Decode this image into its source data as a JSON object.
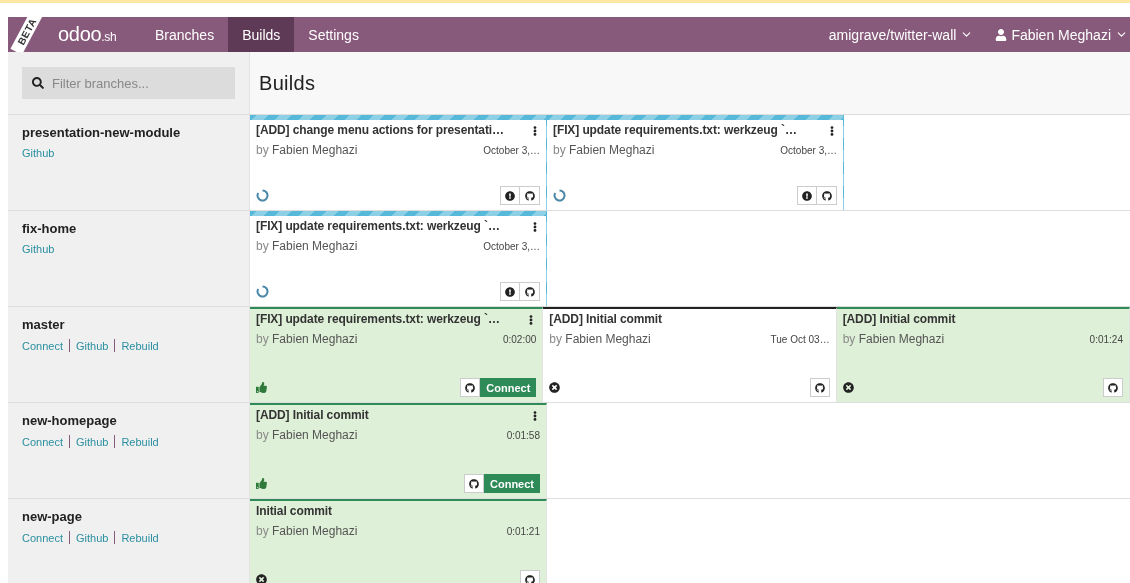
{
  "nav": {
    "beta": "BETA",
    "logo": "odoo",
    "logo_suffix": ".sh",
    "tabs": [
      {
        "label": "Branches",
        "selected": false
      },
      {
        "label": "Builds",
        "selected": true
      },
      {
        "label": "Settings",
        "selected": false
      }
    ],
    "repo": "amigrave/twitter-wall",
    "user": "Fabien Meghazi"
  },
  "search": {
    "placeholder": "Filter branches..."
  },
  "title": "Builds",
  "branches": [
    {
      "name": "presentation-new-module",
      "links": [
        "Github"
      ],
      "builds": [
        {
          "kind": "running",
          "icon": {
            "kind": "pending"
          },
          "menu": true,
          "title": "[ADD] change menu actions for presentati…",
          "by": "by",
          "author": "Fabien Meghazi",
          "time": "October 3,…",
          "actions": [
            {
              "kind": "alert"
            },
            {
              "kind": "github"
            }
          ]
        },
        {
          "kind": "running",
          "icon": {
            "kind": "pending"
          },
          "menu": true,
          "title": "[FIX] update requirements.txt: werkzeug `…",
          "by": "by",
          "author": "Fabien Meghazi",
          "time": "October 3,…",
          "actions": [
            {
              "kind": "alert"
            },
            {
              "kind": "github"
            }
          ]
        }
      ]
    },
    {
      "name": "fix-home",
      "links": [
        "Github"
      ],
      "builds": [
        {
          "kind": "running",
          "icon": {
            "kind": "pending"
          },
          "menu": true,
          "title": "[FIX] update requirements.txt: werkzeug `…",
          "by": "by",
          "author": "Fabien Meghazi",
          "time": "October 3,…",
          "actions": [
            {
              "kind": "alert"
            },
            {
              "kind": "github"
            }
          ]
        }
      ]
    },
    {
      "name": "master",
      "links": [
        "Connect",
        "Github",
        "Rebuild"
      ],
      "builds": [
        {
          "kind": "success",
          "icon": {
            "kind": "ok"
          },
          "menu": true,
          "title": "[FIX] update requirements.txt: werkzeug `…",
          "by": "by",
          "author": "Fabien Meghazi",
          "time": "0:02:00",
          "actions": [
            {
              "kind": "github"
            },
            {
              "kind": "connect",
              "label": "Connect"
            }
          ]
        },
        {
          "kind": "dropped",
          "icon": {
            "kind": "failed"
          },
          "menu": false,
          "title": "[ADD] Initial commit",
          "by": "by",
          "author": "Fabien Meghazi",
          "time": "Tue Oct 03…",
          "actions": [
            {
              "kind": "github"
            }
          ]
        },
        {
          "kind": "success",
          "icon": {
            "kind": "failed"
          },
          "menu": false,
          "title": "[ADD] Initial commit",
          "by": "by",
          "author": "Fabien Meghazi",
          "time": "0:01:24",
          "actions": [
            {
              "kind": "github"
            }
          ]
        }
      ]
    },
    {
      "name": "new-homepage",
      "links": [
        "Connect",
        "Github",
        "Rebuild"
      ],
      "builds": [
        {
          "kind": "success",
          "icon": {
            "kind": "ok"
          },
          "menu": true,
          "title": "[ADD] Initial commit",
          "by": "by",
          "author": "Fabien Meghazi",
          "time": "0:01:58",
          "actions": [
            {
              "kind": "github"
            },
            {
              "kind": "connect",
              "label": "Connect"
            }
          ]
        }
      ]
    },
    {
      "name": "new-page",
      "links": [
        "Connect",
        "Github",
        "Rebuild"
      ],
      "builds": [
        {
          "kind": "success",
          "icon": {
            "kind": "failed"
          },
          "menu": false,
          "title": "Initial commit",
          "by": "by",
          "author": "Fabien Meghazi",
          "time": "0:01:21",
          "actions": [
            {
              "kind": "github"
            }
          ]
        }
      ]
    }
  ]
}
